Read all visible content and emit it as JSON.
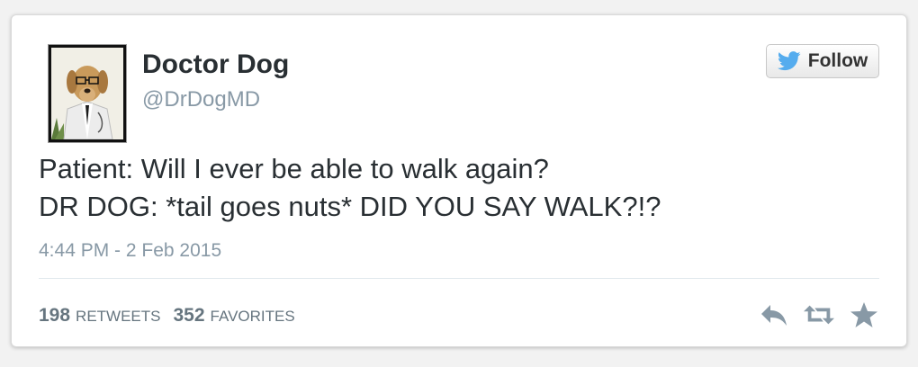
{
  "user": {
    "name": "Doctor Dog",
    "handle": "@DrDogMD"
  },
  "follow_button": {
    "label": "Follow",
    "icon": "twitter-bird-icon",
    "icon_color": "#55acee"
  },
  "tweet": {
    "lines": [
      "Patient: Will I ever be able to walk again?",
      "DR DOG: *tail goes nuts* DID YOU SAY WALK?!?"
    ],
    "timestamp": "4:44 PM - 2 Feb 2015"
  },
  "stats": [
    {
      "count": "198",
      "label": "RETWEETS"
    },
    {
      "count": "352",
      "label": "FAVORITES"
    }
  ],
  "actions": [
    {
      "name": "reply",
      "icon": "reply-icon"
    },
    {
      "name": "retweet",
      "icon": "retweet-icon"
    },
    {
      "name": "favorite",
      "icon": "star-icon"
    }
  ],
  "colors": {
    "text": "#292f33",
    "secondary": "#8899a6",
    "action_icon": "#8899a6",
    "stat": "#66757f"
  }
}
